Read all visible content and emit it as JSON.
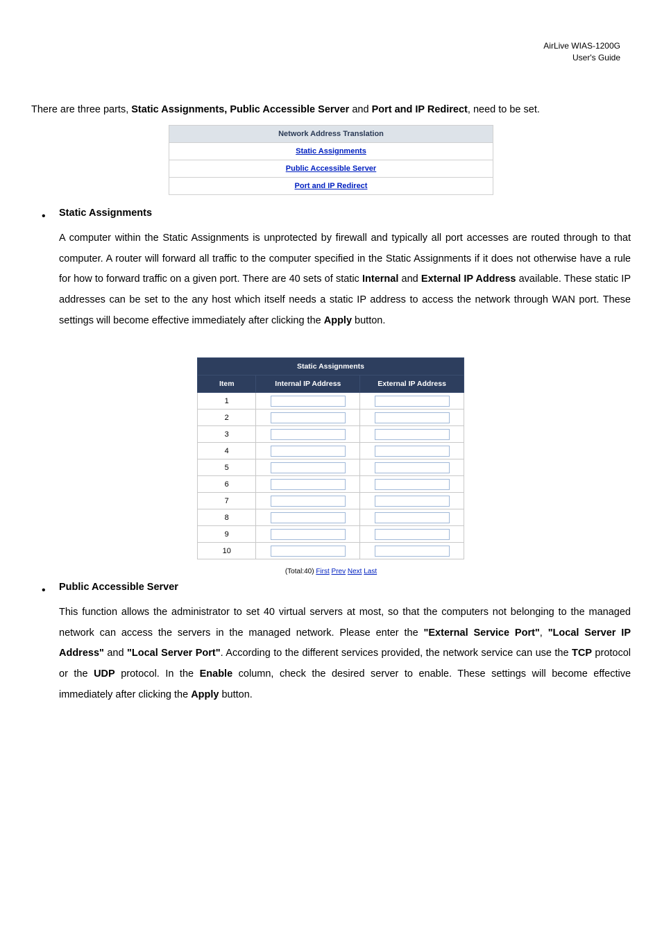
{
  "header": {
    "l1": "AirLive WIAS-1200G",
    "l2": "User's Guide"
  },
  "intro": {
    "t1": "There are three parts, ",
    "b1": "Static Assignments, Public Accessible Server ",
    "t2": "and ",
    "b2": "Port and IP Redirect",
    "t3": ", need to be set."
  },
  "nat": {
    "header": "Network Address Translation",
    "l1": "Static Assignments",
    "l2": "Public Accessible Server",
    "l3": "Port and IP Redirect"
  },
  "sec1": {
    "title": "Static Assignments",
    "body_a": "A computer within the Static Assignments is unprotected by firewall and typically all port accesses are routed through to that computer. A router will forward all traffic to the computer specified in the Static Assignments if it does not otherwise have a rule for how to forward traffic on a given port. There are 40 sets of static ",
    "b1": "Internal",
    "body_b": " and ",
    "b2": "External IP Address",
    "body_c": " available. These static IP addresses can be set to the any host which itself needs a static IP address to access the network through WAN port. These settings will become effective immediately after clicking the ",
    "b3": "Apply",
    "body_d": " button."
  },
  "sa_table": {
    "title": "Static Assignments",
    "h1": "Item",
    "h2": "Internal IP Address",
    "h3": "External IP Address",
    "rows": [
      "1",
      "2",
      "3",
      "4",
      "5",
      "6",
      "7",
      "8",
      "9",
      "10"
    ]
  },
  "pgn": {
    "pre": "(Total:40) ",
    "l1": "First",
    "l2": "Prev",
    "l3": "Next",
    "l4": "Last"
  },
  "sec2": {
    "title": "Public Accessible Server",
    "body_a": "This function allows the administrator to set 40 virtual servers at most, so that the computers not belonging to the managed network can access the servers in the managed network. Please enter the ",
    "b1": "\"External Service Port\"",
    "body_b": ", ",
    "b2": "\"Local Server IP Address\"",
    "body_c": " and ",
    "b3": "\"Local Server Port\"",
    "body_d": ". According to the different services provided, the network service can use the ",
    "b4": "TCP",
    "body_e": " protocol or the ",
    "b5": "UDP",
    "body_f": " protocol. In the ",
    "b6": "Enable",
    "body_g": " column, check the desired server to enable. These settings will become effective immediately after clicking the ",
    "b7": "Apply",
    "body_h": " button."
  }
}
